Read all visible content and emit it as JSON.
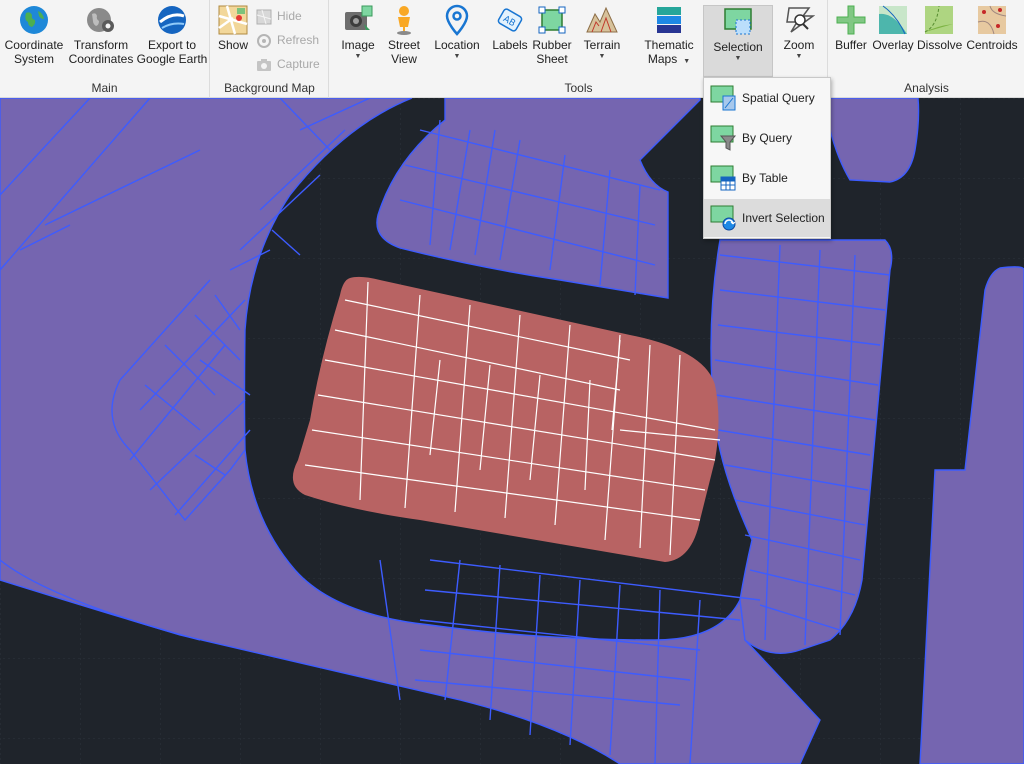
{
  "ribbon": {
    "groups": {
      "main": "Main",
      "background_map": "Background Map",
      "tools": "Tools",
      "analysis": "Analysis"
    },
    "buttons": {
      "coordinate_system": [
        "Coordinate",
        "System"
      ],
      "transform_coordinates": [
        "Transform",
        "Coordinates"
      ],
      "export_google_earth": [
        "Export to",
        "Google Earth"
      ],
      "show": "Show",
      "hide": "Hide",
      "refresh": "Refresh",
      "capture": "Capture",
      "image": "Image",
      "street_view": [
        "Street",
        "View"
      ],
      "location": "Location",
      "labels": "Labels",
      "rubber_sheet": [
        "Rubber",
        "Sheet"
      ],
      "terrain": "Terrain",
      "thematic_maps": [
        "Thematic",
        "Maps"
      ],
      "selection": "Selection",
      "zoom": "Zoom",
      "buffer": "Buffer",
      "overlay": "Overlay",
      "dissolve": "Dissolve",
      "centroids": "Centroids"
    }
  },
  "selection_menu": {
    "items": [
      "Spatial Query",
      "By Query",
      "By Table",
      "Invert Selection"
    ],
    "hovered": "Invert Selection"
  },
  "colors": {
    "map_background": "#1f242b",
    "parcel_fill": "#7565b0",
    "parcel_stroke": "#3d5cff",
    "selected_fill": "#b86363",
    "selected_stroke": "#ffffff",
    "ribbon_bg": "#f4f4f4"
  }
}
